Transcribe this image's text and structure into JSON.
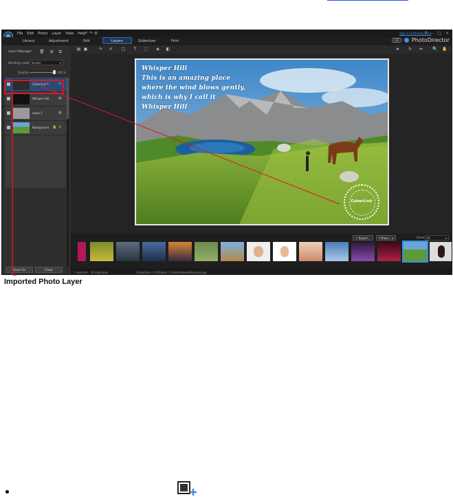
{
  "app": {
    "menu": [
      "File",
      "Edit",
      "Photo",
      "Layer",
      "View",
      "Help"
    ],
    "signin": "Sign in to DirectorZone",
    "window_controls": [
      "?",
      "–",
      "□",
      "×"
    ],
    "module_tabs": [
      "Library",
      "Adjustment",
      "Edit",
      "Layers",
      "Slideshow",
      "Print"
    ],
    "active_tab": "Layers",
    "brand_badge": "ASK",
    "brand_name": "PhotoDirector"
  },
  "layer_manager": {
    "title": "Layer Manager",
    "blending_label": "Blending mode:",
    "blending_value": "Screen",
    "opacity_label": "Opacity:",
    "opacity_value": "100 %",
    "opacity_fraction": 1.0,
    "layers": [
      {
        "name": "CyberLink T..."
      },
      {
        "name": "Whisper Hill..."
      },
      {
        "name": "Layer 1"
      },
      {
        "name": "Background"
      }
    ],
    "buttons": {
      "save": "Save As",
      "clear": "Clear"
    }
  },
  "photo": {
    "text_lines": [
      "Whisper Hill",
      "This is an amazing place",
      "where the wind blows gently,",
      "which is why I call it",
      "Whisper Hill"
    ],
    "seal_text": "CyberLink"
  },
  "filmstrip": {
    "export_label": "Export...",
    "share_label": "Share...",
    "zoom_label": "Zoom:",
    "zoom_value": "Fit"
  },
  "status": {
    "selection": "1 selected - 18 displayed",
    "path": "Collections / All Photos / ContentAwareRemoval.jpg"
  },
  "callout": {
    "label": "Imported Photo Layer"
  },
  "colors": {
    "accent": "#3b8fe5",
    "callout": "#d8182c",
    "link": "#2a4fd6"
  }
}
